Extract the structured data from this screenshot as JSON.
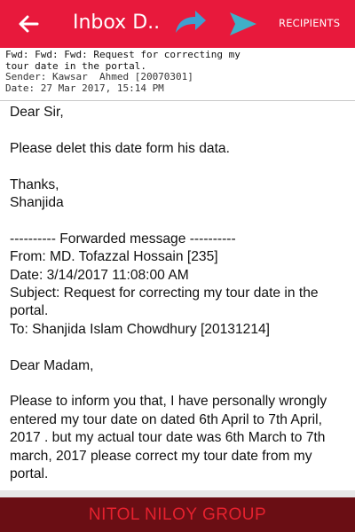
{
  "colors": {
    "appbar": "#e8193c",
    "reply_icon": "#3f9fd0",
    "send_icon": "#3fb0c8",
    "footer_bg": "#6a0e14",
    "footer_text": "#e5212e"
  },
  "appbar": {
    "back_icon": "arrow-left-icon",
    "title": "Inbox D...",
    "reply_icon": "reply-arrow-icon",
    "send_icon": "send-icon",
    "recipients_label": "RECIPIENTS"
  },
  "header": {
    "subject_lines": [
      "Fwd: Fwd: Fwd: Request for correcting my",
      "tour date in the portal."
    ],
    "sender": "Sender: Kawsar  Ahmed [20070301]",
    "date": "Date: 27 Mar 2017, 15:14 PM"
  },
  "body": {
    "greeting": "Dear Sir,",
    "request": "Please delet this date form his data.",
    "thanks": "Thanks,",
    "signature": "Shanjida",
    "forward_marker": "---------- Forwarded message ----------",
    "fwd_from": "From: MD. Tofazzal Hossain [235]",
    "fwd_date": "Date: 3/14/2017 11:08:00 AM",
    "fwd_subject": "Subject: Request for correcting my tour date in the portal.",
    "fwd_to": "To: Shanjida Islam Chowdhury [20131214]",
    "greeting2": "Dear Madam,",
    "message": "Please to inform you that, I have personally wrongly entered my tour date on dated 6th April to 7th April, 2017 . but my actual tour date was 6th March to 7th march, 2017 please correct my tour date from my portal."
  },
  "footer": {
    "text": "NITOL NILOY GROUP"
  }
}
